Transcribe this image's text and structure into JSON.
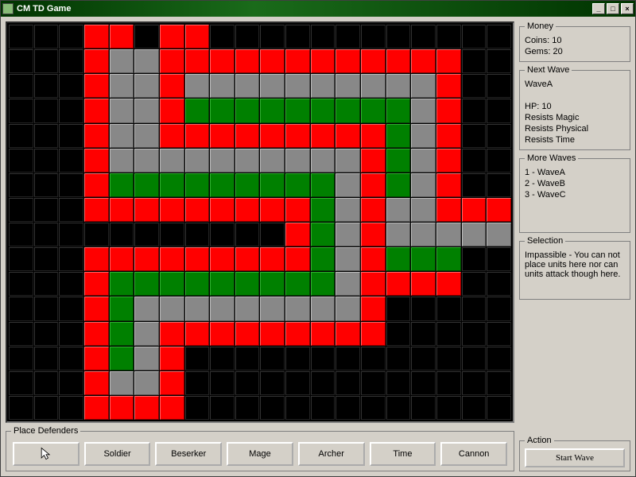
{
  "window": {
    "title": "CM TD Game"
  },
  "money": {
    "legend": "Money",
    "coins_label": "Coins: 10",
    "gems_label": "Gems: 20"
  },
  "next_wave": {
    "legend": "Next Wave",
    "name": "WaveA",
    "hp": "HP: 10",
    "resist1": "Resists Magic",
    "resist2": "Resists Physical",
    "resist3": "Resists Time"
  },
  "more_waves": {
    "legend": "More Waves",
    "items": [
      "1 - WaveA",
      "2 - WaveB",
      "3 - WaveC"
    ]
  },
  "selection": {
    "legend": "Selection",
    "text": "Impassible - You can not place units here nor can units attack though here."
  },
  "action": {
    "legend": "Action",
    "start_label": "Start Wave"
  },
  "defenders": {
    "legend": "Place Defenders",
    "buttons": [
      "",
      "Soldier",
      "Beserker",
      "Mage",
      "Archer",
      "Time",
      "Cannon"
    ]
  },
  "map": {
    "cols": 20,
    "rows": 16,
    "legend": {
      "k": "black",
      "r": "red",
      "g": "green",
      "e": "grey"
    },
    "grid": [
      "kkkrrkrrkkkkkkkkkkkk",
      "kkkreerrrrrrrrrrrrkk",
      "kkkreereeeeeeeeeerkk",
      "kkkreergggggggggerkk",
      "kkkreerrrrrrrrrgerkk",
      "kkkreeeeeeeeeergerkk",
      "kkkrgggggggggergerkk",
      "kkkrrrrrrrrrgereerrr",
      "kkkkkkkkkkkrgereeeee",
      "kkkrrrrrrrrrgergggkk",
      "kkkrgggggggggerrrrkk",
      "kkkrgeeeeeeeeerkkkkk",
      "kkkrgerrrrrrrrrkkkkk",
      "kkkrgerkkkkkkkkkkkkk",
      "kkkreerkkkkkkkkkkkkk",
      "kkkrrrrkkkkkkkkkkkkk"
    ]
  }
}
